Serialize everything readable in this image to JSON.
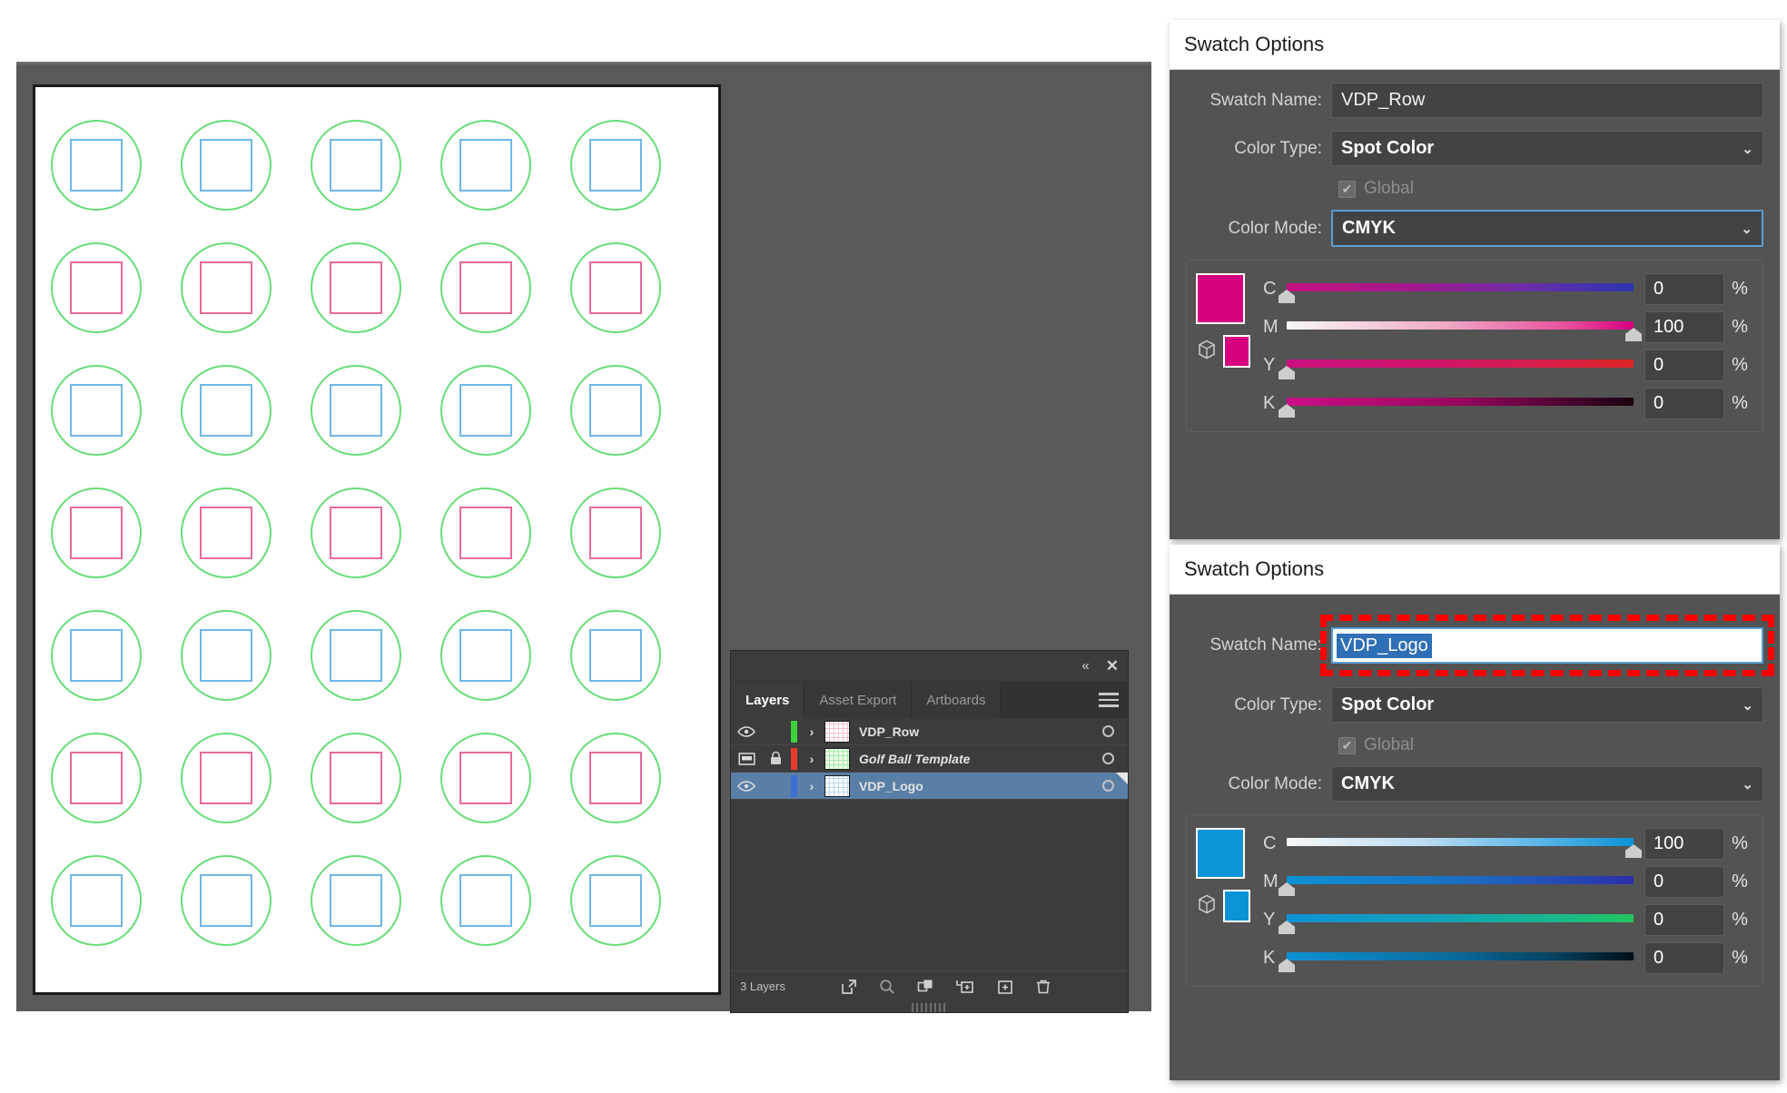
{
  "artwork": {
    "name": "golf-ball-template-artboard",
    "rows": 7,
    "cols": 5,
    "row_colors": [
      "blue",
      "pink",
      "blue",
      "pink",
      "blue",
      "pink",
      "blue"
    ],
    "circle_color": "#66dd77",
    "blue_color": "#6fb6e8",
    "pink_color": "#e8699c"
  },
  "layers_panel": {
    "collapse_icon": "«",
    "close_icon": "✕",
    "tabs": [
      {
        "label": "Layers",
        "active": true
      },
      {
        "label": "Asset Export",
        "active": false
      },
      {
        "label": "Artboards",
        "active": false
      }
    ],
    "rows": [
      {
        "name": "VDP_Row",
        "visible": true,
        "locked": false,
        "selected": false,
        "italic": false,
        "color_bar": "#3ed13e",
        "expand_icon": "›",
        "eye_icon": "eye",
        "target_icon": "○"
      },
      {
        "name": "Golf Ball Template",
        "visible": true,
        "locked": true,
        "selected": false,
        "italic": true,
        "color_bar": "#e8392f",
        "expand_icon": "›",
        "eye_icon": "template",
        "target_icon": "○"
      },
      {
        "name": "VDP_Logo",
        "visible": true,
        "locked": false,
        "selected": true,
        "italic": false,
        "color_bar": "#3d6fd1",
        "expand_icon": "›",
        "eye_icon": "eye",
        "target_icon": "○"
      }
    ],
    "footer": {
      "count_label": "3 Layers",
      "icons": [
        "locate-object-icon",
        "search-icon",
        "make-clipping-mask-icon",
        "create-new-sublayer-icon",
        "create-new-layer-icon",
        "delete-selection-icon"
      ]
    }
  },
  "dialogs": [
    {
      "title": "Swatch Options",
      "swatch_name_label": "Swatch Name:",
      "swatch_name_value": "VDP_Row",
      "swatch_name_highlighted": false,
      "color_type_label": "Color Type:",
      "color_type_value": "Spot Color",
      "global_label": "Global",
      "global_checked": true,
      "color_mode_label": "Color Mode:",
      "color_mode_value": "CMYK",
      "color_mode_focused": true,
      "preview_color": "#d6007f",
      "channels": [
        {
          "letter": "C",
          "value": "0",
          "unit": "%",
          "track": "linear-gradient(90deg,#c4107f 0%,#a51a8e 35%,#6a2ea8 70%,#2b35b0 100%)"
        },
        {
          "letter": "M",
          "value": "100",
          "unit": "%",
          "track": "linear-gradient(90deg,#f6f6f6 0%,#f0a9c8 45%,#e8539c 80%,#d6007f 100%)"
        },
        {
          "letter": "Y",
          "value": "0",
          "unit": "%",
          "track": "linear-gradient(90deg,#cc0f81 0%,#d01467 45%,#d81f45 78%,#dd2424 100%)"
        },
        {
          "letter": "K",
          "value": "0",
          "unit": "%",
          "track": "linear-gradient(90deg,#cc0f85 0%,#98075f 50%,#4c0430 80%,#1a0210 100%)"
        }
      ]
    },
    {
      "title": "Swatch Options",
      "swatch_name_label": "Swatch Name:",
      "swatch_name_value": "VDP_Logo",
      "swatch_name_highlighted": true,
      "color_type_label": "Color Type:",
      "color_type_value": "Spot Color",
      "global_label": "Global",
      "global_checked": true,
      "color_mode_label": "Color Mode:",
      "color_mode_value": "CMYK",
      "color_mode_focused": false,
      "preview_color": "#0b93d5",
      "channels": [
        {
          "letter": "C",
          "value": "100",
          "unit": "%",
          "track": "linear-gradient(90deg,#f7f7f7 0%,#b9dcf2 40%,#54b3e6 75%,#0b93d5 100%)"
        },
        {
          "letter": "M",
          "value": "0",
          "unit": "%",
          "track": "linear-gradient(90deg,#0e92d4 0%,#1a74c4 45%,#2450b8 75%,#2b2fab 100%)"
        },
        {
          "letter": "Y",
          "value": "0",
          "unit": "%",
          "track": "linear-gradient(90deg,#0e92d4 0%,#14a2b8 45%,#1bb88c 78%,#23c45f 100%)"
        },
        {
          "letter": "K",
          "value": "0",
          "unit": "%",
          "track": "linear-gradient(90deg,#0e92d4 0%,#0a6a9c 48%,#05405e 78%,#020f18 100%)"
        }
      ]
    }
  ],
  "annotation": {
    "highlight_color": "#ff0000",
    "highlight_style": "dashed-rectangle",
    "target": "swatch-name-field"
  }
}
